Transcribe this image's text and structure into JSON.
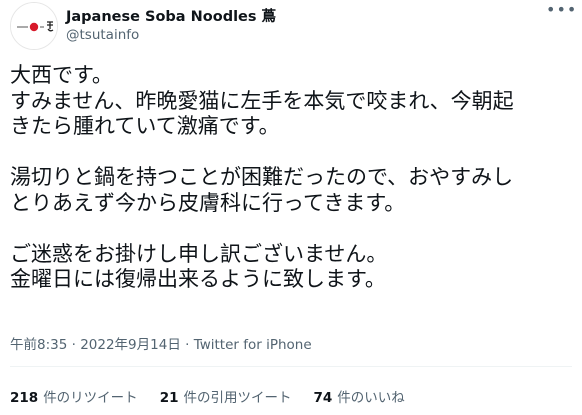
{
  "tweet": {
    "author_name": "Japanese Soba Noodles 蔦",
    "author_handle": "@tsutainfo",
    "more_icon": "•••",
    "body_lines": [
      "大西です。",
      "すみません、昨晩愛猫に左手を本気で咬まれ、今朝起",
      "きたら腫れていて激痛です。",
      "",
      "湯切りと鍋を持つことが困難だったので、おやすみし",
      "とりあえず今から皮膚科に行ってきます。",
      "",
      "ご迷惑をお掛けし申し訳ございません。",
      "金曜日には復帰出来るように致します。"
    ],
    "time": "午前8:35",
    "date": "2022年9月14日",
    "source": "Twitter for iPhone",
    "separator": " · "
  },
  "stats": {
    "retweets_count": "218",
    "retweets_label": "件のリツイート",
    "quotes_count": "21",
    "quotes_label": "件の引用ツイート",
    "likes_count": "74",
    "likes_label": "件のいいね"
  }
}
